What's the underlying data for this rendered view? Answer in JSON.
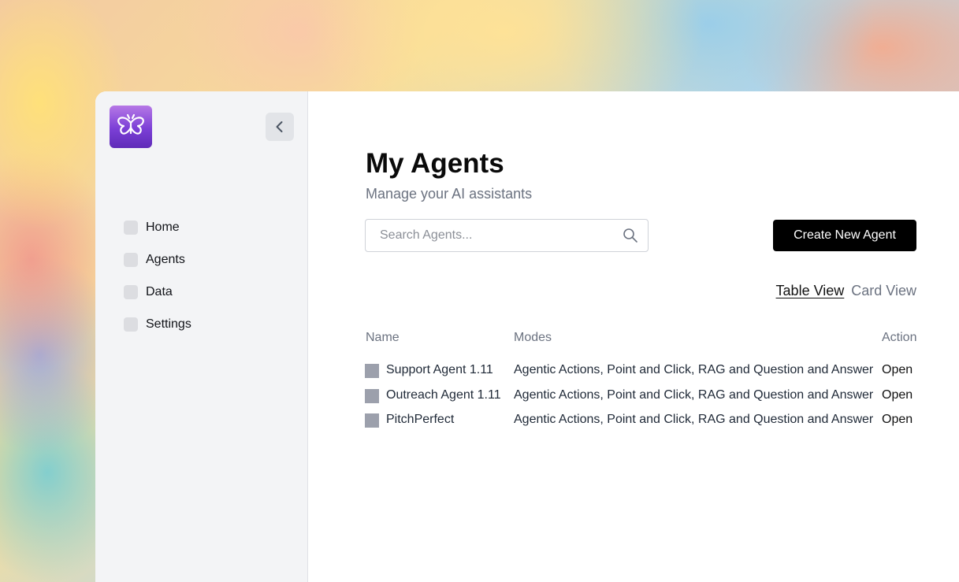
{
  "sidebar": {
    "logo_icon": "butterfly-icon",
    "collapse_icon": "chevron-left-icon",
    "items": [
      {
        "label": "Home"
      },
      {
        "label": "Agents"
      },
      {
        "label": "Data"
      },
      {
        "label": "Settings"
      }
    ]
  },
  "main": {
    "title": "My Agents",
    "subtitle": "Manage your AI assistants",
    "search": {
      "placeholder": "Search Agents...",
      "value": "",
      "icon": "search-icon"
    },
    "create_button": "Create New Agent",
    "views": {
      "table": "Table View",
      "card": "Card View",
      "active": "table"
    },
    "table": {
      "headers": {
        "name": "Name",
        "modes": "Modes",
        "action": "Action"
      },
      "rows": [
        {
          "name": "Support Agent 1.11",
          "modes": "Agentic Actions, Point and Click, RAG and Question and Answer",
          "action": "Open"
        },
        {
          "name": "Outreach Agent 1.11",
          "modes": "Agentic Actions, Point and Click, RAG and Question and Answer",
          "action": "Open"
        },
        {
          "name": "PitchPerfect",
          "modes": "Agentic Actions, Point and Click, RAG and Question and Answer",
          "action": "Open"
        }
      ]
    }
  },
  "colors": {
    "logo_gradient_top": "#b678e6",
    "logo_gradient_bottom": "#5f2bb8",
    "primary_button": "#000000",
    "sidebar_bg": "#f3f4f6",
    "muted_text": "#6b7280"
  }
}
